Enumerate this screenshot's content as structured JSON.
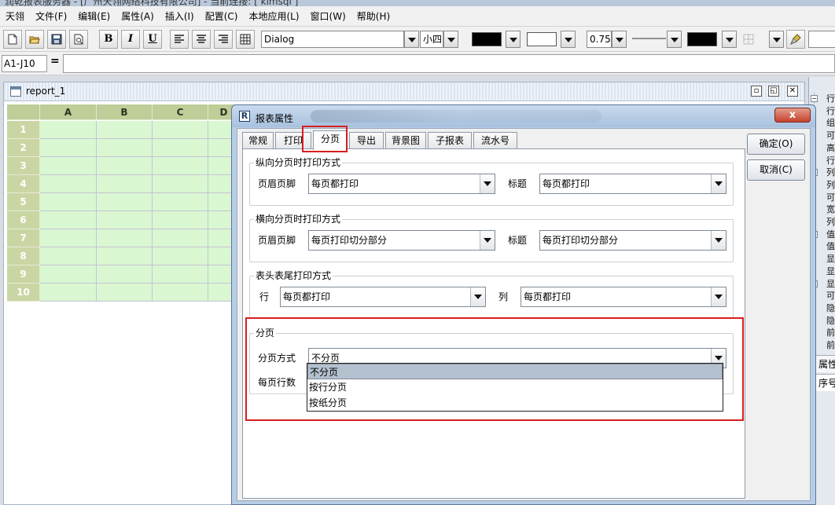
{
  "app": {
    "title_fragment": "润乾报表服务器 - [广州天翎网络科技有限公司] - 当前连接: [ kimsql ]"
  },
  "menubar": [
    {
      "label": "天翎"
    },
    {
      "label": "文件(F)"
    },
    {
      "label": "编辑(E)"
    },
    {
      "label": "属性(A)"
    },
    {
      "label": "插入(I)"
    },
    {
      "label": "配置(C)"
    },
    {
      "label": "本地应用(L)"
    },
    {
      "label": "窗口(W)"
    },
    {
      "label": "帮助(H)"
    }
  ],
  "toolbar": {
    "bold": "B",
    "italic": "I",
    "underline": "U",
    "font_name": "Dialog",
    "font_size": "小四",
    "foreground_color": "#000000",
    "background_color": "#ffffff",
    "line_width": "0.75",
    "border_color": "#000000",
    "icons": [
      "new-icon",
      "open-icon",
      "save-icon",
      "preview-icon",
      "align-left-icon",
      "align-center-icon",
      "align-right-icon",
      "table-grid-icon",
      "line-style-icon",
      "border-icon",
      "format-brush-icon"
    ]
  },
  "formula": {
    "cell_ref": "A1-J10",
    "equals": "=",
    "value": ""
  },
  "document": {
    "title": "report_1",
    "columns": [
      "A",
      "B",
      "C",
      "D"
    ],
    "rows": [
      "1",
      "2",
      "3",
      "4",
      "5",
      "6",
      "7",
      "8",
      "9",
      "10"
    ],
    "header_color": "#bfcd98",
    "cell_color": "#d9f7d1"
  },
  "right_panel": {
    "items": [
      "行",
      "行",
      "组",
      "可",
      "高",
      "行",
      "列",
      "列",
      "可",
      "宽",
      "列",
      "值",
      "值",
      "显",
      "显",
      "显",
      "可",
      "隐",
      "隐",
      "前",
      "前"
    ],
    "section_label": "属性",
    "section_label2": "序号"
  },
  "dialog": {
    "title": "报表属性",
    "close": "x",
    "tabs": [
      {
        "label": "常规"
      },
      {
        "label": "打印"
      },
      {
        "label": "分页"
      },
      {
        "label": "导出"
      },
      {
        "label": "背景图"
      },
      {
        "label": "子报表"
      },
      {
        "label": "流水号"
      }
    ],
    "active_tab": "分页",
    "ok": "确定(O)",
    "cancel": "取消(C)",
    "vertical": {
      "title": "纵向分页时打印方式",
      "header_footer_label": "页眉页脚",
      "header_footer_value": "每页都打印",
      "title_label": "标题",
      "title_value": "每页都打印"
    },
    "horizontal": {
      "title": "横向分页时打印方式",
      "header_footer_label": "页眉页脚",
      "header_footer_value": "每页打印切分部分",
      "title_label": "标题",
      "title_value": "每页打印切分部分"
    },
    "head_tail": {
      "title": "表头表尾打印方式",
      "row_label": "行",
      "row_value": "每页都打印",
      "col_label": "列",
      "col_value": "每页都打印"
    },
    "paging": {
      "title": "分页",
      "mode_label": "分页方式",
      "mode_value": "不分页",
      "rows_label": "每页行数",
      "options": [
        "不分页",
        "按行分页",
        "按纸分页"
      ],
      "selected_option": "不分页"
    }
  },
  "highlight_color": "#d81e1e"
}
